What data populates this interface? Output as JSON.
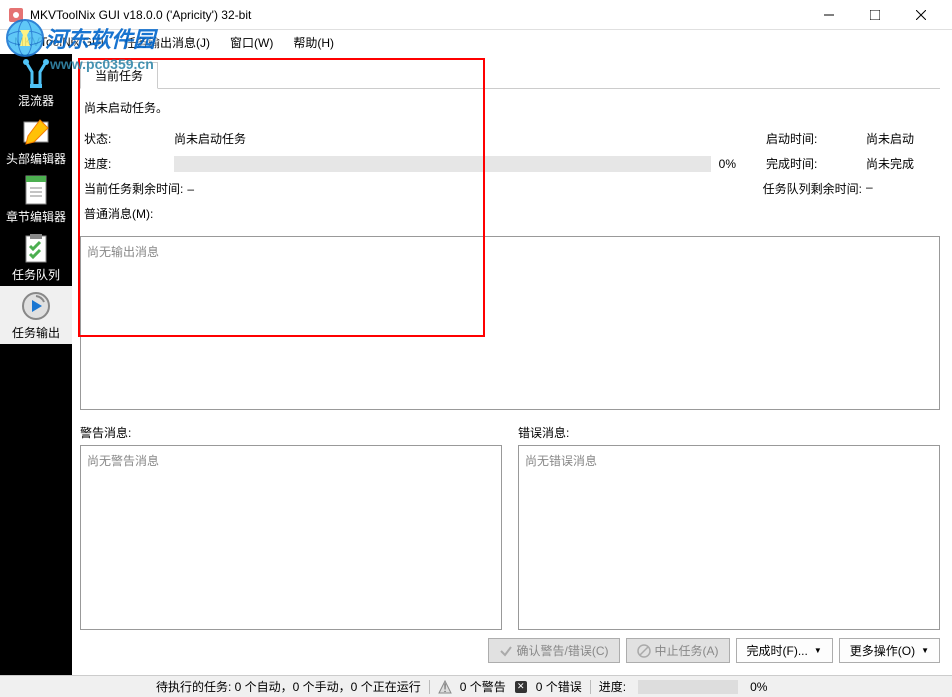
{
  "window": {
    "title": "MKVToolNix GUI v18.0.0 ('Apricity') 32-bit"
  },
  "menu": {
    "gui": "MKVToolNix GUI",
    "job_output": "任务输出消息(J)",
    "window": "窗口(W)",
    "help": "帮助(H)"
  },
  "watermark": {
    "site_name": "河东软件园",
    "url": "www.pc0359.cn"
  },
  "sidebar": {
    "items": [
      {
        "label": "混流器"
      },
      {
        "label": "头部编辑器"
      },
      {
        "label": "章节编辑器"
      },
      {
        "label": "任务队列"
      },
      {
        "label": "任务输出"
      }
    ]
  },
  "tab": {
    "current": "当前任务"
  },
  "task": {
    "no_task_msg": "尚未启动任务。",
    "status_label": "状态:",
    "status_value": "尚未启动任务",
    "progress_label": "进度:",
    "progress_pct": "0%",
    "start_time_label": "启动时间:",
    "start_time_value": "尚未启动",
    "finish_time_label": "完成时间:",
    "finish_time_value": "尚未完成",
    "current_remaining_label": "当前任务剩余时间:",
    "current_remaining_value": "–",
    "queue_remaining_label": "任务队列剩余时间:",
    "queue_remaining_value": "–",
    "normal_msg_label": "普通消息(M):",
    "normal_msg_placeholder": "尚无输出消息",
    "warn_msg_label": "警告消息:",
    "warn_msg_placeholder": "尚无警告消息",
    "error_msg_label": "错误消息:",
    "error_msg_placeholder": "尚无错误消息"
  },
  "actions": {
    "ack": "确认警告/错误(C)",
    "abort": "中止任务(A)",
    "on_finish": "完成时(F)...",
    "more": "更多操作(O)"
  },
  "status": {
    "pending": "待执行的任务: 0 个自动，0 个手动，0 个正在运行",
    "warnings": "0 个警告",
    "errors": "0 个错误",
    "progress_label": "进度:",
    "progress_pct": "0%"
  }
}
